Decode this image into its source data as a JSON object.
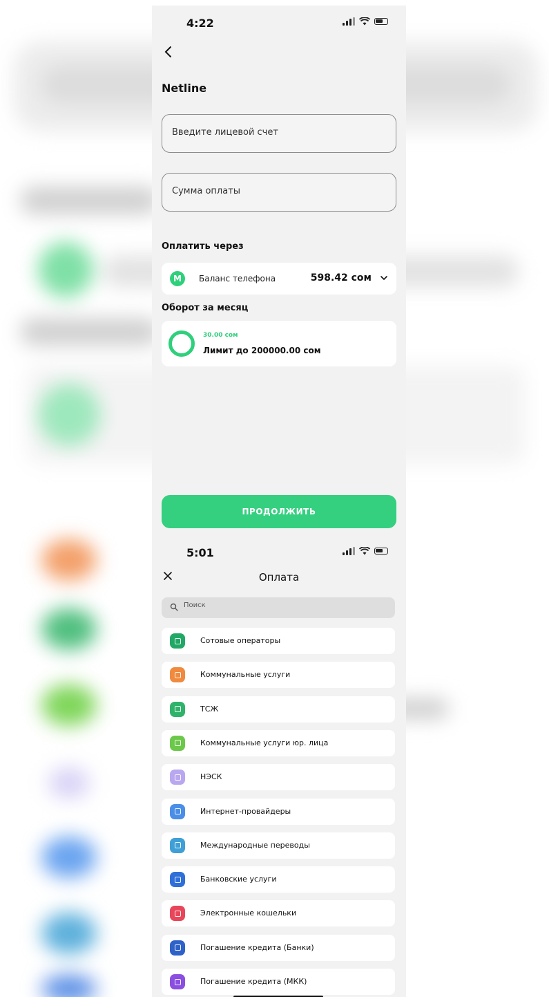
{
  "screen1": {
    "status": {
      "time": "4:22"
    },
    "provider_title": "Netline",
    "account_field": {
      "placeholder": "Введите лицевой счет"
    },
    "amount_field": {
      "placeholder": "Сумма оплаты"
    },
    "pay_via_label": "Оплатить через",
    "pay_source": {
      "badge": "M",
      "name": "Баланс телефона",
      "amount": "598.42 сом"
    },
    "turnover_label": "Оборот за месяц",
    "turnover": {
      "used": "30.00 сом",
      "limit": "Лимит до 200000.00 сом"
    },
    "continue_label": "ПРОДОЛЖИТЬ",
    "accent_color": "#34d07f"
  },
  "screen2": {
    "status": {
      "time": "5:01"
    },
    "title": "Оплата",
    "search_placeholder": "Поиск",
    "categories": [
      {
        "label": "Сотовые операторы",
        "icon": "phone-icon",
        "color": "#22a866"
      },
      {
        "label": "Коммунальные услуги",
        "icon": "home-icon",
        "color": "#f08a3e"
      },
      {
        "label": "ТСЖ",
        "icon": "building-icon",
        "color": "#2fb36b"
      },
      {
        "label": "Коммунальные услуги юр. лица",
        "icon": "office-icon",
        "color": "#6cc84a"
      },
      {
        "label": "НЭСК",
        "icon": "power-icon",
        "color": "#b9a7f0"
      },
      {
        "label": "Интернет-провайдеры",
        "icon": "router-icon",
        "color": "#4a8ee8"
      },
      {
        "label": "Международные переводы",
        "icon": "globe-icon",
        "color": "#3f9fd6"
      },
      {
        "label": "Банковские услуги",
        "icon": "bank-icon",
        "color": "#2f6fd8"
      },
      {
        "label": "Электронные кошельки",
        "icon": "wallet-icon",
        "color": "#e8465a"
      },
      {
        "label": "Погашение кредита (Банки)",
        "icon": "credit-icon",
        "color": "#2f62c8"
      },
      {
        "label": "Погашение кредита (МКК)",
        "icon": "loan-icon",
        "color": "#8a4fe0"
      }
    ]
  }
}
